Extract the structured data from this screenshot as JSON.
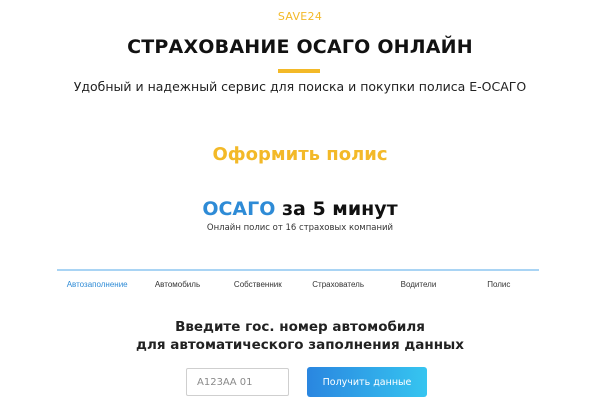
{
  "brand": "SAVE24",
  "title": "СТРАХОВАНИЕ ОСАГО ОНЛАЙН",
  "subtitle": "Удобный и надежный сервис для поиска и покупки полиса Е-ОСАГО",
  "cta": "Оформить полис",
  "headline": {
    "accent": "ОСАГО",
    "rest": "за 5 минут"
  },
  "subhead": "Онлайн полис от 16 страховых компаний",
  "steps": [
    "Автозаполнение",
    "Автомобиль",
    "Собственник",
    "Страхователь",
    "Водители",
    "Полис"
  ],
  "active_step": 0,
  "prompt": {
    "line1": "Введите гос. номер автомобиля",
    "line2": "для автоматического заполнения данных"
  },
  "plate_input": {
    "placeholder": "А123АА 01",
    "value": ""
  },
  "submit_label": "Получить данные",
  "colors": {
    "accent_yellow": "#f3b928",
    "accent_blue": "#2e8bd6",
    "step_line": "#a9d4f4"
  }
}
